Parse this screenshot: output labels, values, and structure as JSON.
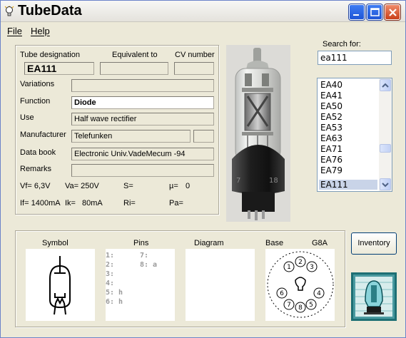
{
  "window": {
    "title": "TubeData"
  },
  "menu": {
    "file": "File",
    "help": "Help"
  },
  "header_labels": {
    "tube_designation": "Tube designation",
    "equivalent_to": "Equivalent to",
    "cv_number": "CV number"
  },
  "tube": {
    "designation": "EA111",
    "equivalent_to": "",
    "cv_number": "",
    "variations": "",
    "function": "Diode",
    "use": "Half wave rectifier",
    "manufacturer": "Telefunken",
    "manufacturer_extra": "",
    "data_book": "Electronic Univ.VadeMecum -94",
    "remarks": ""
  },
  "field_labels": {
    "variations": "Variations",
    "function": "Function",
    "use": "Use",
    "manufacturer": "Manufacturer",
    "data_book": "Data book",
    "remarks": "Remarks"
  },
  "params": {
    "vf": "Vf= 6,3V",
    "va": "Va= 250V",
    "s": "S=",
    "mu": "µ=",
    "mu_val": "0",
    "if": "If= 1400mA",
    "ik": "Ik=",
    "ik_val": "80mA",
    "ri": "Ri=",
    "pa": "Pa="
  },
  "search": {
    "label": "Search for:",
    "value": "ea111"
  },
  "tube_list": {
    "items": [
      "EA40",
      "EA41",
      "EA50",
      "EA52",
      "EA53",
      "EA63",
      "EA71",
      "EA76",
      "EA79",
      "EA111"
    ],
    "selected": "EA111"
  },
  "bottom_labels": {
    "symbol": "Symbol",
    "pins": "Pins",
    "diagram": "Diagram",
    "base": "Base",
    "base_type": "G8A"
  },
  "pins": {
    "left": [
      "1:",
      "2:",
      "3:",
      "4:",
      "5: h",
      "6: h"
    ],
    "right": [
      "7:",
      "8: a"
    ]
  },
  "base_pins": [
    "1",
    "2",
    "3",
    "4",
    "5",
    "6",
    "7",
    "8"
  ],
  "buttons": {
    "inventory": "Inventory"
  },
  "photo_labels": {
    "left_mark": "7",
    "right_mark": "18"
  },
  "colors": {
    "title_bar": "#eeede8",
    "window_bg": "#ece9d8",
    "selection": "#c9d4e8",
    "close_button": "#d4532a"
  }
}
